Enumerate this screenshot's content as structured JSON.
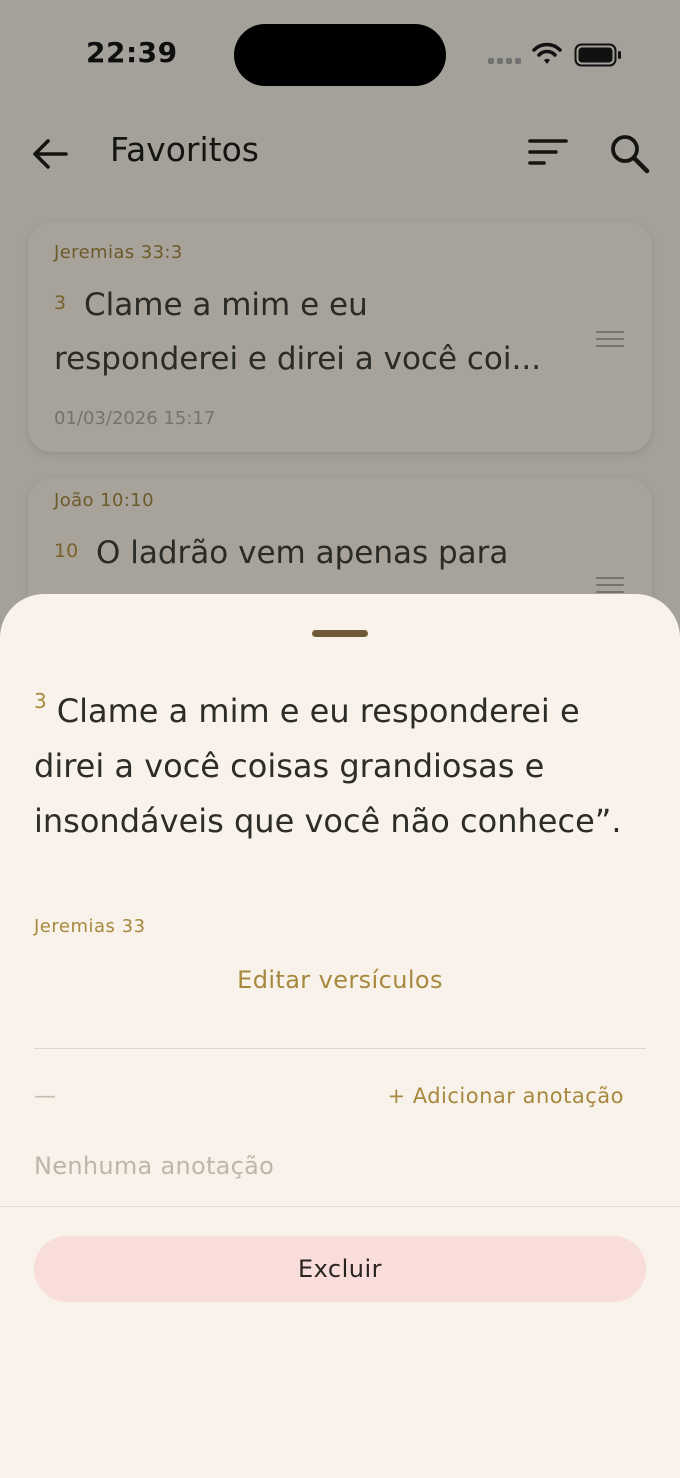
{
  "status_bar": {
    "time": "22:39"
  },
  "header": {
    "title": "Favoritos"
  },
  "favorites": [
    {
      "reference": "Jeremias 33:3",
      "verse_number": "3",
      "text": "Clame a mim e eu",
      "text_line2": "responderei e direi a você coi...",
      "date": "01/03/2026 15:17"
    },
    {
      "reference": "João 10:10",
      "verse_number": "10",
      "text": "O ladrão vem apenas para"
    }
  ],
  "sheet": {
    "verse_number": "3",
    "verse_text": "Clame a mim e eu responderei e direi a você coisas grandiosas e insondáveis que você não conhece”.",
    "chapter_reference": "Jeremias 33",
    "edit_label": "Editar versículos",
    "note_placeholder": "—",
    "add_note_label": "+ Adicionar anotação",
    "empty_note_text": "Nenhuma anotação",
    "delete_label": "Excluir"
  },
  "colors": {
    "accent": "#a6893e",
    "sheet_background": "#f8f2ea",
    "delete_background": "#f8ddda",
    "scrim": "#a4a19a"
  }
}
